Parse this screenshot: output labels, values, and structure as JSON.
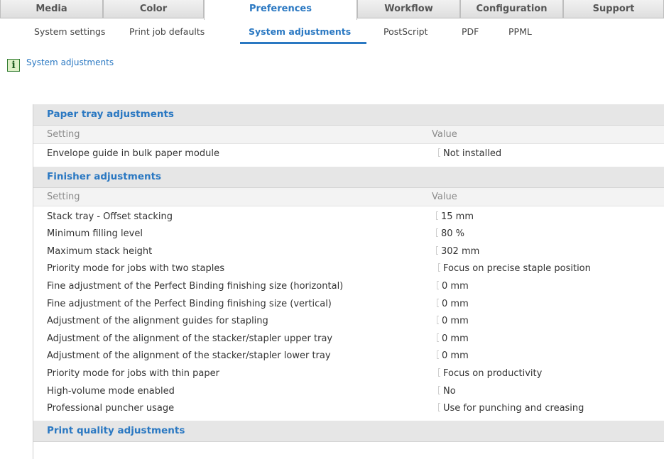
{
  "tabs": [
    {
      "label": "Media",
      "active": false
    },
    {
      "label": "Color",
      "active": false
    },
    {
      "label": "Preferences",
      "active": true
    },
    {
      "label": "Workflow",
      "active": false
    },
    {
      "label": "Configuration",
      "active": false
    },
    {
      "label": "Support",
      "active": false
    }
  ],
  "subtabs": [
    {
      "label": "System settings",
      "active": false
    },
    {
      "label": "Print job defaults",
      "active": false
    },
    {
      "label": "System adjustments",
      "active": true
    },
    {
      "label": "PostScript",
      "active": false
    },
    {
      "label": "PDF",
      "active": false
    },
    {
      "label": "PPML",
      "active": false
    }
  ],
  "info": {
    "icon": "info-icon",
    "glyph": "i",
    "text": "System adjustments"
  },
  "columns": {
    "setting": "Setting",
    "value": "Value"
  },
  "sections": [
    {
      "title": "Paper tray adjustments",
      "rows": [
        {
          "setting": "Envelope guide in bulk paper module",
          "value": "Not installed"
        }
      ]
    },
    {
      "title": "Finisher adjustments",
      "rows": [
        {
          "setting": "Stack tray - Offset stacking",
          "value": "15 mm"
        },
        {
          "setting": "Minimum filling level",
          "value": "80 %"
        },
        {
          "setting": "Maximum stack height",
          "value": "302 mm"
        },
        {
          "setting": "Priority mode for jobs with two staples",
          "value": "Focus on precise staple position"
        },
        {
          "setting": "Fine adjustment of the Perfect Binding finishing size (horizontal)",
          "value": "0 mm"
        },
        {
          "setting": "Fine adjustment of the Perfect Binding finishing size (vertical)",
          "value": "0 mm"
        },
        {
          "setting": "Adjustment of the alignment guides for stapling",
          "value": "0 mm"
        },
        {
          "setting": "Adjustment of the alignment of the stacker/stapler upper tray",
          "value": "0 mm"
        },
        {
          "setting": "Adjustment of the alignment of the stacker/stapler lower tray",
          "value": "0 mm"
        },
        {
          "setting": "Priority mode for jobs with thin paper",
          "value": "Focus on productivity"
        },
        {
          "setting": "High-volume mode enabled",
          "value": "No"
        },
        {
          "setting": "Professional puncher usage",
          "value": "Use for punching and creasing"
        }
      ]
    },
    {
      "title": "Print quality adjustments",
      "rows": []
    }
  ],
  "colors": {
    "accent": "#2a78c2",
    "section_bg": "#e6e6e6",
    "column_bg": "#f3f3f3"
  }
}
